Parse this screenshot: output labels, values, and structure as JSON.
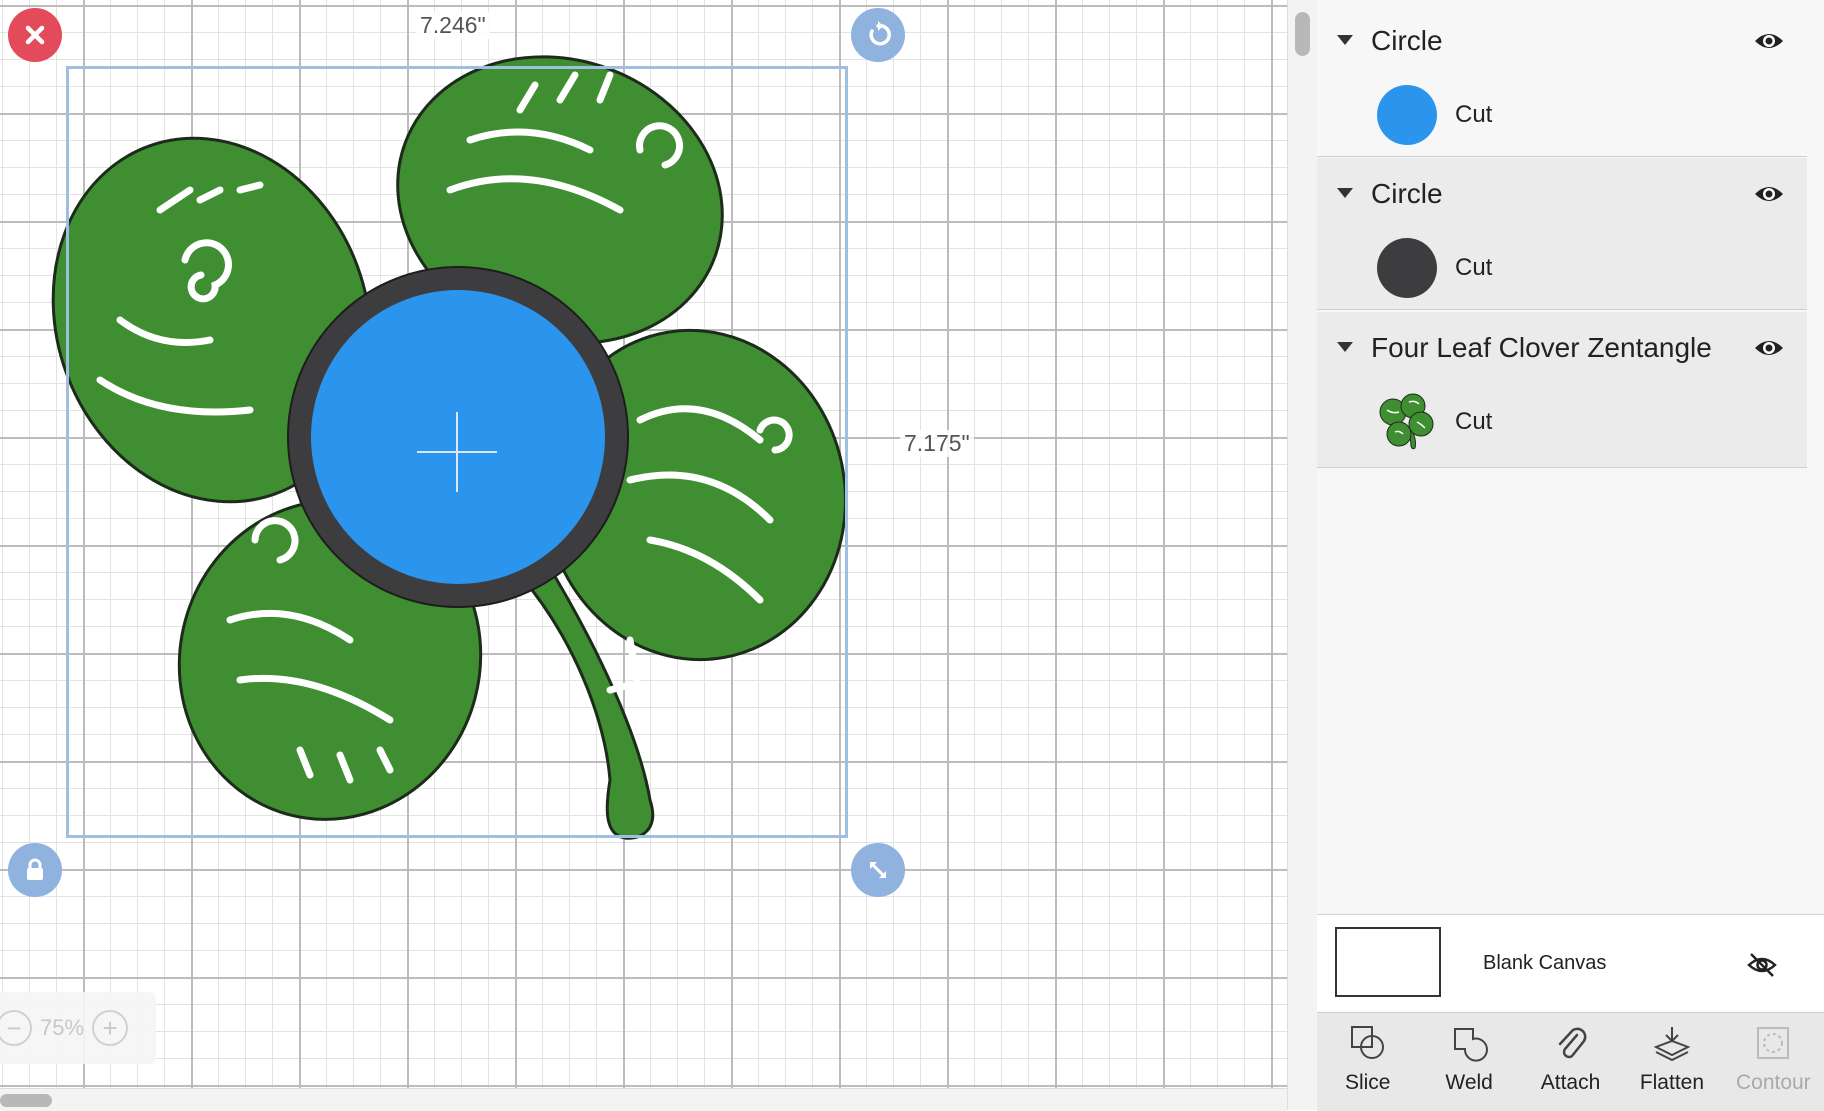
{
  "canvas": {
    "width_label": "7.246\"",
    "height_label": "7.175\"",
    "zoom": "75%",
    "colors": {
      "selection": "#9fbfe0",
      "clover": "#3f8f32",
      "outline": "#1d2b1a",
      "blue_circle": "#2b95ee",
      "dark_circle": "#3d3d3f",
      "delete": "#e34a5a",
      "handle": "#8fb2de"
    }
  },
  "layers": [
    {
      "title": "Circle",
      "items": [
        {
          "label": "Cut",
          "color": "#2b95ee",
          "icon": "blue-circle-swatch"
        }
      ]
    },
    {
      "title": "Circle",
      "items": [
        {
          "label": "Cut",
          "color": "#3d3d3f",
          "icon": "dark-circle-swatch"
        }
      ]
    },
    {
      "title": "Four Leaf Clover Zentangle",
      "items": [
        {
          "label": "Cut",
          "color": "#3f8f32",
          "icon": "clover-thumbnail"
        }
      ]
    }
  ],
  "blank_canvas": {
    "label": "Blank Canvas"
  },
  "toolbar": {
    "slice": "Slice",
    "weld": "Weld",
    "attach": "Attach",
    "flatten": "Flatten",
    "contour": "Contour"
  },
  "icons": [
    "close-icon",
    "rotate-icon",
    "lock-icon",
    "resize-icon",
    "eye-icon",
    "eye-hidden-icon",
    "slice-icon",
    "weld-icon",
    "attach-icon",
    "flatten-icon",
    "contour-icon"
  ]
}
